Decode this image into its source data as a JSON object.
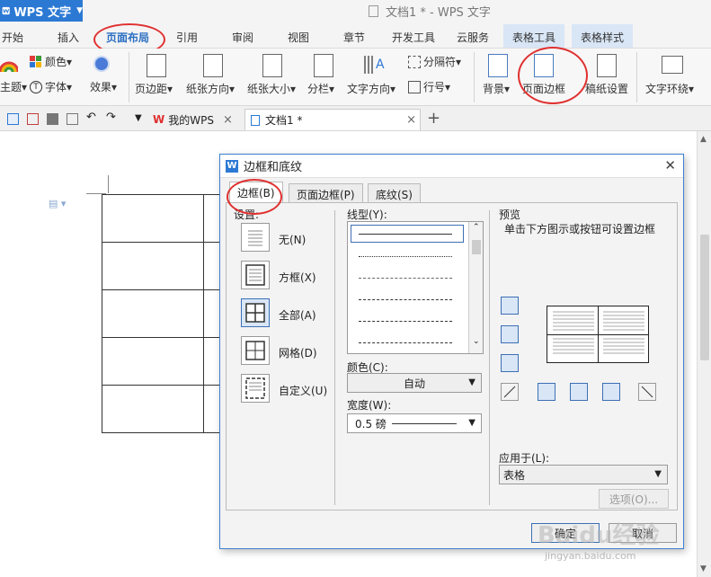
{
  "app": {
    "name": "WPS 文字",
    "window_title": "文档1 * - WPS 文字"
  },
  "menu": {
    "tabs": [
      "开始",
      "插入",
      "页面布局",
      "引用",
      "审阅",
      "视图",
      "章节",
      "开发工具",
      "云服务",
      "表格工具",
      "表格样式"
    ],
    "active": "页面布局"
  },
  "ribbon": {
    "theme": "主题",
    "color": "颜色",
    "font": "字体",
    "effect": "效果",
    "margin": "页边距",
    "orientation": "纸张方向",
    "paper_size": "纸张大小",
    "columns": "分栏",
    "text_direction": "文字方向",
    "separator": "分隔符",
    "line_number": "行号",
    "background": "背景",
    "page_border": "页面边框",
    "draft_setting": "稿纸设置",
    "text_wrap": "文字环绕"
  },
  "doc_tabs": [
    {
      "label": "我的WPS"
    },
    {
      "label": "文档1 *"
    }
  ],
  "dialog": {
    "title": "边框和底纹",
    "tabs": [
      "边框(B)",
      "页面边框(P)",
      "底纹(S)"
    ],
    "settings_label": "设置:",
    "settings": [
      "无(N)",
      "方框(X)",
      "全部(A)",
      "网格(D)",
      "自定义(U)"
    ],
    "line_style_label": "线型(Y):",
    "color_label": "颜色(C):",
    "color_value": "自动",
    "width_label": "宽度(W):",
    "width_value": "0.5  磅",
    "preview_label": "预览",
    "preview_hint": "单击下方图示或按钮可设置边框",
    "apply_label": "应用于(L):",
    "apply_value": "表格",
    "options_button": "选项(O)...",
    "ok_button": "确定",
    "cancel_button": "取消"
  },
  "watermark": {
    "text": "Baidu经验",
    "sub": "jingyan.baidu.com"
  },
  "colors": {
    "accent": "#2c79d4",
    "annotation": "#e03030",
    "tool_tab": "#d9e6f6"
  }
}
